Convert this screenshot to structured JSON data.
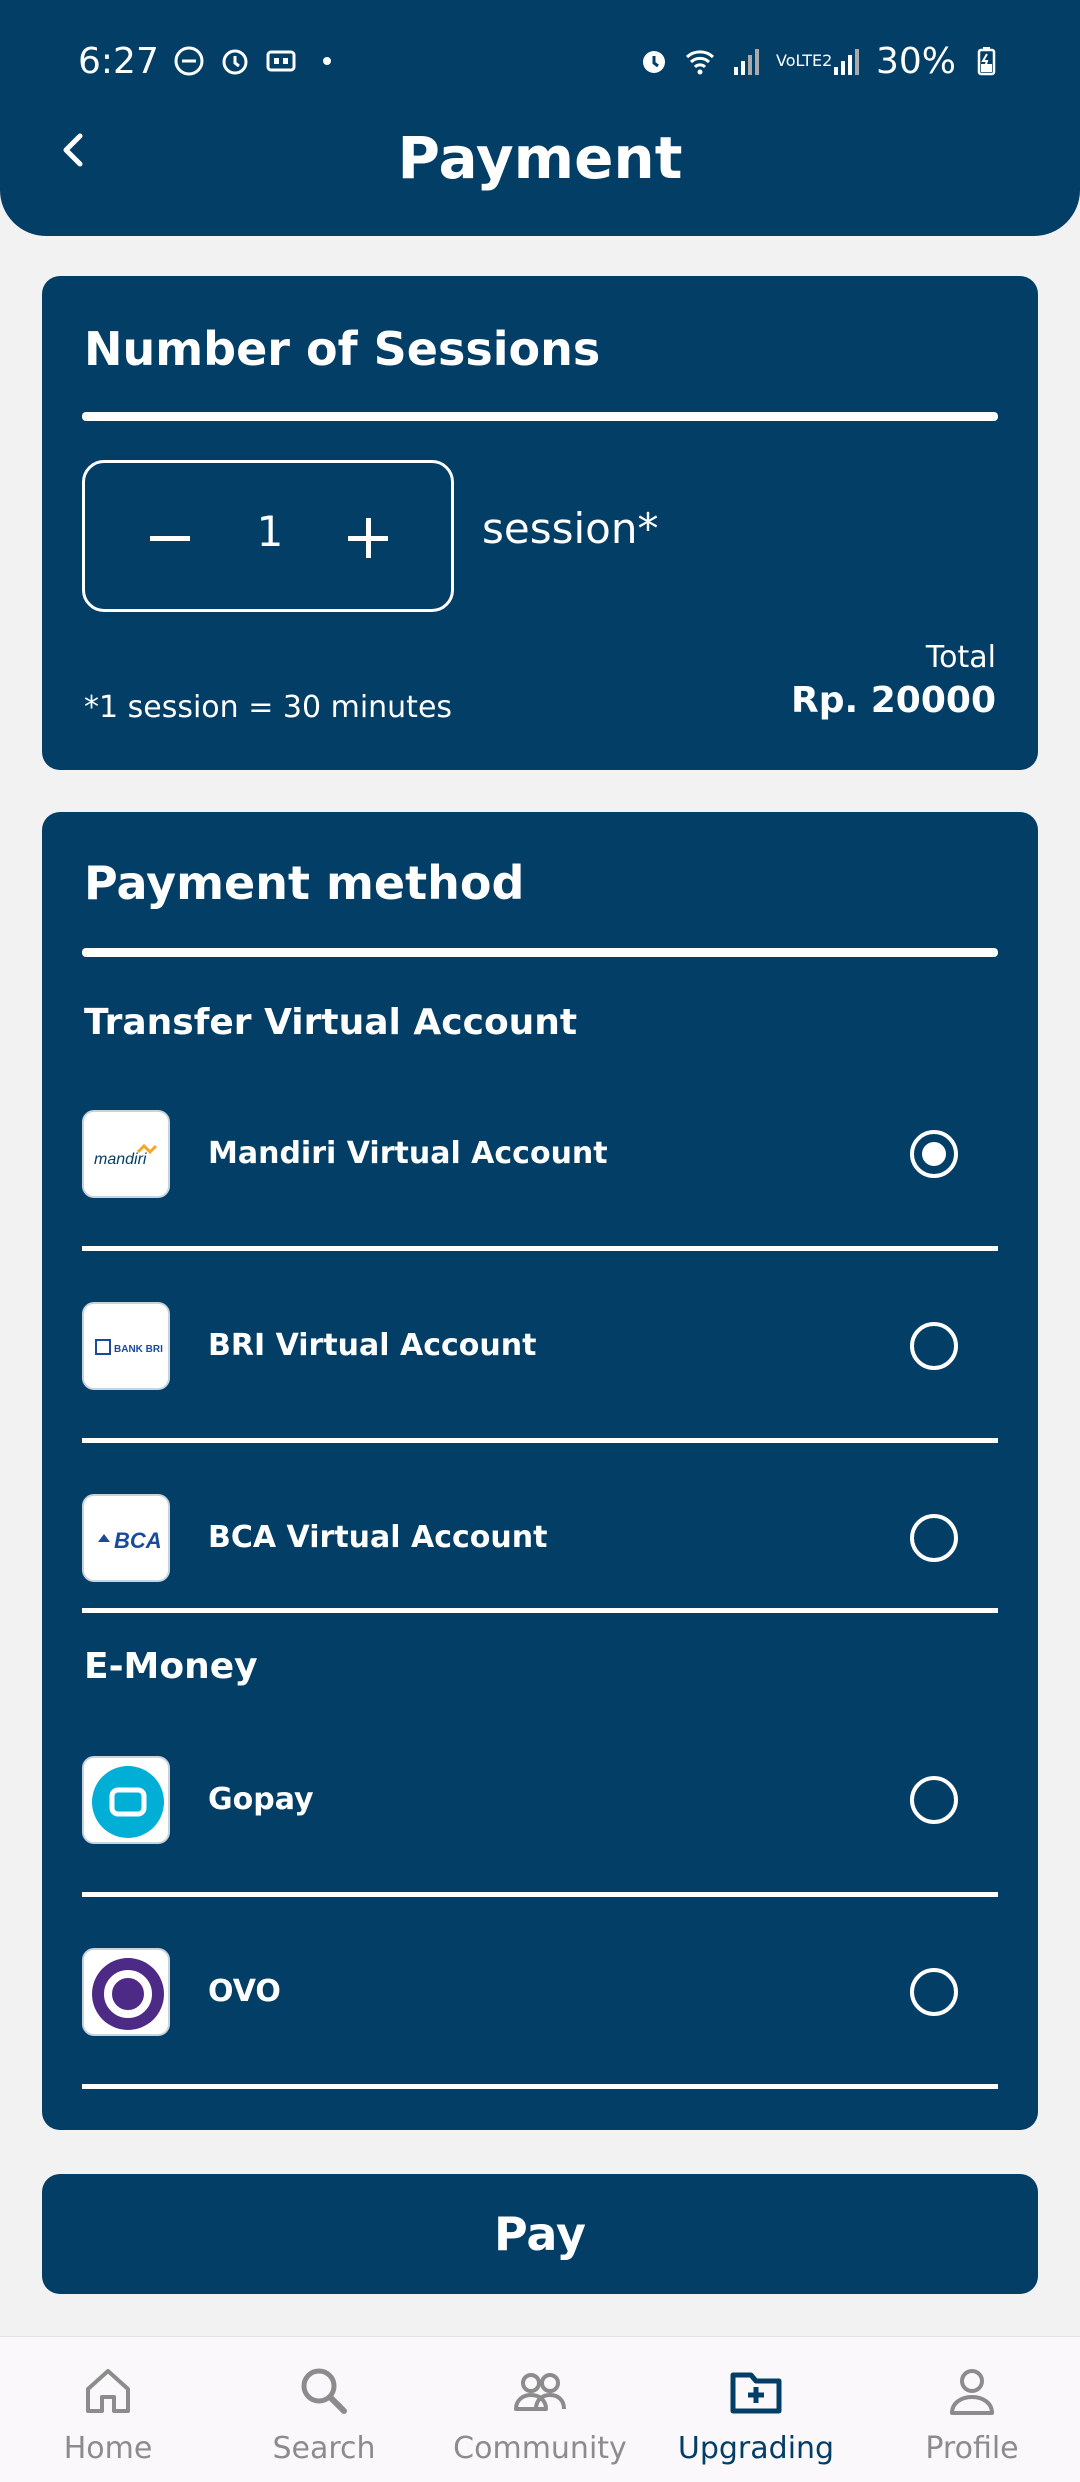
{
  "status_bar": {
    "time": "6:27",
    "battery": "30%",
    "network": "VoLTE2"
  },
  "header": {
    "title": "Payment"
  },
  "sessions": {
    "title": "Number of Sessions",
    "count": "1",
    "unit_label": "session*",
    "note": "*1 session = 30 minutes",
    "total_label": "Total",
    "total_value": "Rp. 20000"
  },
  "payment": {
    "title": "Payment method",
    "transfer_label": "Transfer Virtual Account",
    "emoney_label": "E-Money",
    "methods": [
      {
        "name": "Mandiri Virtual Account",
        "logo_text": "mandiri",
        "selected": true
      },
      {
        "name": "BRI Virtual Account",
        "logo_text": "BANK BRI",
        "selected": false
      },
      {
        "name": "BCA Virtual Account",
        "logo_text": "BCA",
        "selected": false
      },
      {
        "name": "Gopay",
        "logo_text": "",
        "selected": false
      },
      {
        "name": "OVO",
        "logo_text": "",
        "selected": false
      }
    ]
  },
  "pay_button": "Pay",
  "nav": {
    "items": [
      {
        "label": "Home",
        "icon": "home-icon"
      },
      {
        "label": "Search",
        "icon": "search-icon"
      },
      {
        "label": "Community",
        "icon": "community-icon"
      },
      {
        "label": "Upgrading",
        "icon": "folder-add-icon",
        "active": true
      },
      {
        "label": "Profile",
        "icon": "profile-icon"
      }
    ]
  },
  "colors": {
    "primary": "#023e65",
    "background": "#f2f2f2",
    "nav_inactive": "#8c8c8c"
  }
}
